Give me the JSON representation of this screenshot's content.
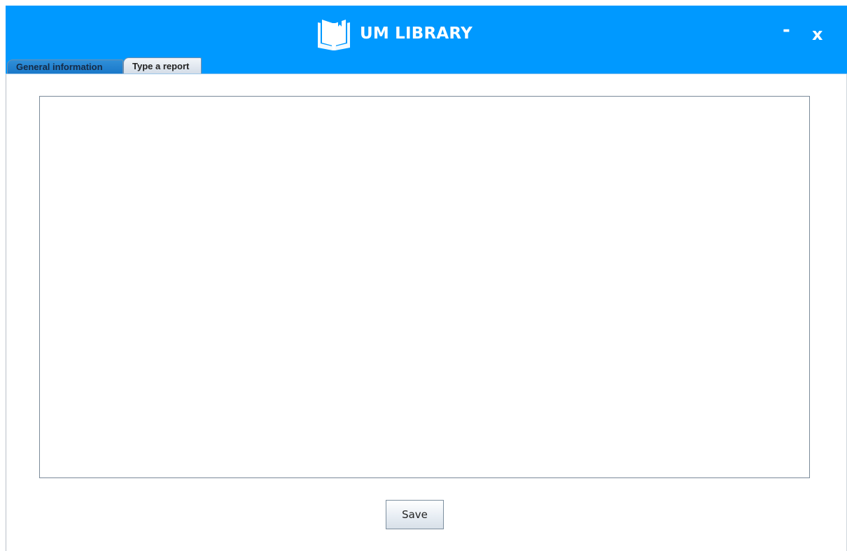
{
  "app": {
    "title": "UM LIBRARY",
    "logo_icon": "open-book-icon",
    "accent_color": "#0099ff"
  },
  "window_controls": {
    "minimize_label": "-",
    "close_label": "x"
  },
  "tabs": [
    {
      "label": "General information",
      "active": false
    },
    {
      "label": "Type a report",
      "active": true
    }
  ],
  "report": {
    "value": "",
    "placeholder": ""
  },
  "actions": {
    "save_label": "Save"
  }
}
